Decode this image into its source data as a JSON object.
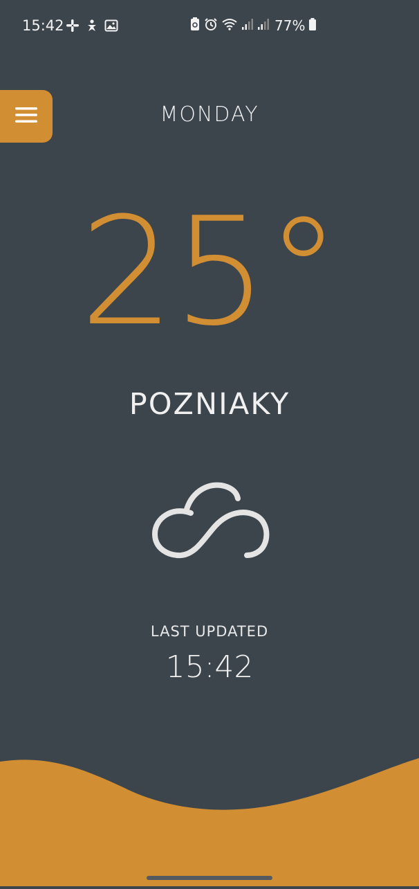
{
  "status_bar": {
    "time": "15:42",
    "battery_percent": "77%",
    "left_icons": [
      "slack-icon",
      "accessibility-icon",
      "image-icon"
    ],
    "right_icons": [
      "battery-saver-icon",
      "alarm-icon",
      "wifi-icon",
      "signal-icon",
      "signal-icon",
      "battery-icon"
    ]
  },
  "menu": {
    "icon": "hamburger-menu-icon"
  },
  "weather": {
    "day": "MONDAY",
    "temperature": "25°",
    "location": "POZNIAKY",
    "condition_icon": "cloud-icon",
    "last_updated_label": "LAST UPDATED",
    "last_updated_time": "15:42"
  },
  "colors": {
    "background": "#3c444c",
    "accent": "#d18e33",
    "text": "#f0f0f0"
  }
}
